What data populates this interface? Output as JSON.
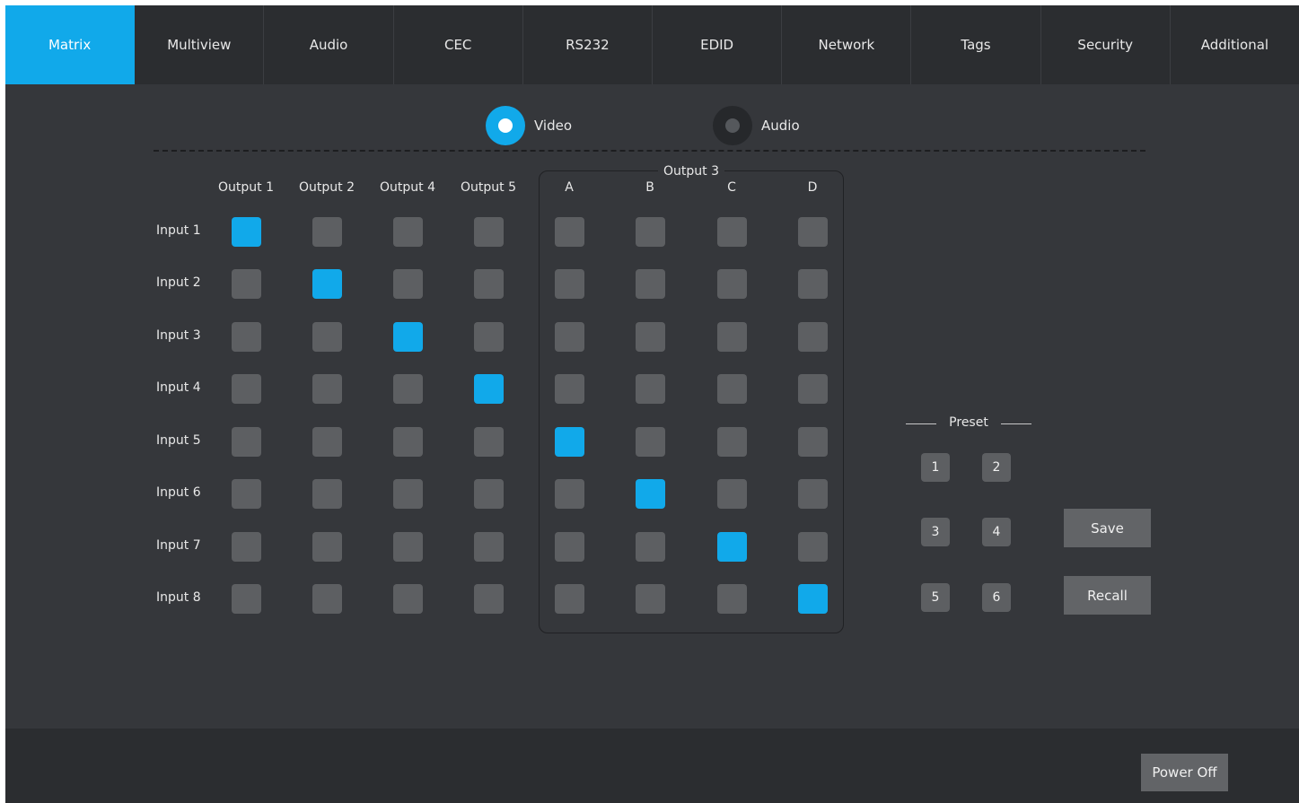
{
  "tabs": [
    {
      "label": "Matrix",
      "active": true
    },
    {
      "label": "Multiview",
      "active": false
    },
    {
      "label": "Audio",
      "active": false
    },
    {
      "label": "CEC",
      "active": false
    },
    {
      "label": "RS232",
      "active": false
    },
    {
      "label": "EDID",
      "active": false
    },
    {
      "label": "Network",
      "active": false
    },
    {
      "label": "Tags",
      "active": false
    },
    {
      "label": "Security",
      "active": false
    },
    {
      "label": "Additional",
      "active": false
    }
  ],
  "mode": {
    "video_label": "Video",
    "audio_label": "Audio",
    "selected": "Video"
  },
  "matrix": {
    "output_group_title": "Output 3",
    "columns": [
      "Output 1",
      "Output 2",
      "Output 4",
      "Output 5",
      "A",
      "B",
      "C",
      "D"
    ],
    "rows": [
      "Input 1",
      "Input 2",
      "Input 3",
      "Input 4",
      "Input 5",
      "Input 6",
      "Input 7",
      "Input 8"
    ],
    "selected_column_per_row": [
      0,
      1,
      2,
      3,
      4,
      5,
      6,
      7
    ]
  },
  "preset": {
    "title": "Preset",
    "buttons": [
      "1",
      "2",
      "3",
      "4",
      "5",
      "6"
    ],
    "save_label": "Save",
    "recall_label": "Recall"
  },
  "footer": {
    "power_off_label": "Power Off"
  },
  "colors": {
    "accent": "#11a9ea",
    "background": "#35373b",
    "bar": "#2b2d30",
    "cell_off": "#5d5f62"
  }
}
